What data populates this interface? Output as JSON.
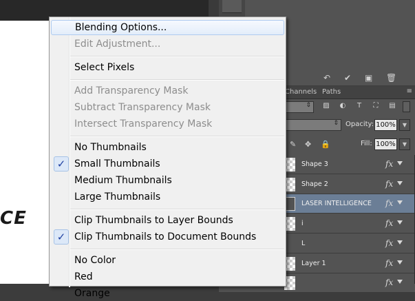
{
  "canvas": {
    "logo_fragment": "CE"
  },
  "layers_panel": {
    "tabs": [
      "Channels",
      "Paths"
    ],
    "opacity_label": "Opacity:",
    "opacity_value": "100%",
    "fill_label": "Fill:",
    "fill_value": "100%",
    "layers": [
      {
        "name": "Shape 3",
        "thumb": "shape",
        "fx": "fx",
        "selected": false
      },
      {
        "name": "Shape 2",
        "thumb": "shape",
        "fx": "fx",
        "selected": false
      },
      {
        "name": "LASER  INTELLIGENCE",
        "thumb": "text",
        "fx": "fx",
        "selected": true
      },
      {
        "name": "i",
        "thumb": "transparent",
        "fx": "fx",
        "selected": false
      },
      {
        "name": "L",
        "thumb": "blank",
        "fx": "fx",
        "selected": false
      },
      {
        "name": "Layer 1",
        "thumb": "transparent",
        "fx": "fx",
        "selected": false
      },
      {
        "name": "",
        "thumb": "transparent",
        "fx": "fx",
        "selected": false
      }
    ]
  },
  "context_menu": {
    "groups": [
      [
        {
          "label": "Blending Options...",
          "enabled": true,
          "highlighted": true
        },
        {
          "label": "Edit Adjustment...",
          "enabled": false
        }
      ],
      [
        {
          "label": "Select Pixels",
          "enabled": true
        }
      ],
      [
        {
          "label": "Add Transparency Mask",
          "enabled": false
        },
        {
          "label": "Subtract Transparency Mask",
          "enabled": false
        },
        {
          "label": "Intersect Transparency Mask",
          "enabled": false
        }
      ],
      [
        {
          "label": "No Thumbnails",
          "enabled": true,
          "checked": false
        },
        {
          "label": "Small Thumbnails",
          "enabled": true,
          "checked": true
        },
        {
          "label": "Medium Thumbnails",
          "enabled": true,
          "checked": false
        },
        {
          "label": "Large Thumbnails",
          "enabled": true,
          "checked": false
        }
      ],
      [
        {
          "label": "Clip Thumbnails to Layer Bounds",
          "enabled": true,
          "checked": false
        },
        {
          "label": "Clip Thumbnails to Document Bounds",
          "enabled": true,
          "checked": true
        }
      ],
      [
        {
          "label": "No Color",
          "enabled": true
        },
        {
          "label": "Red",
          "enabled": true
        },
        {
          "label": "Orange",
          "enabled": true
        }
      ]
    ],
    "check_glyph": "✓"
  }
}
